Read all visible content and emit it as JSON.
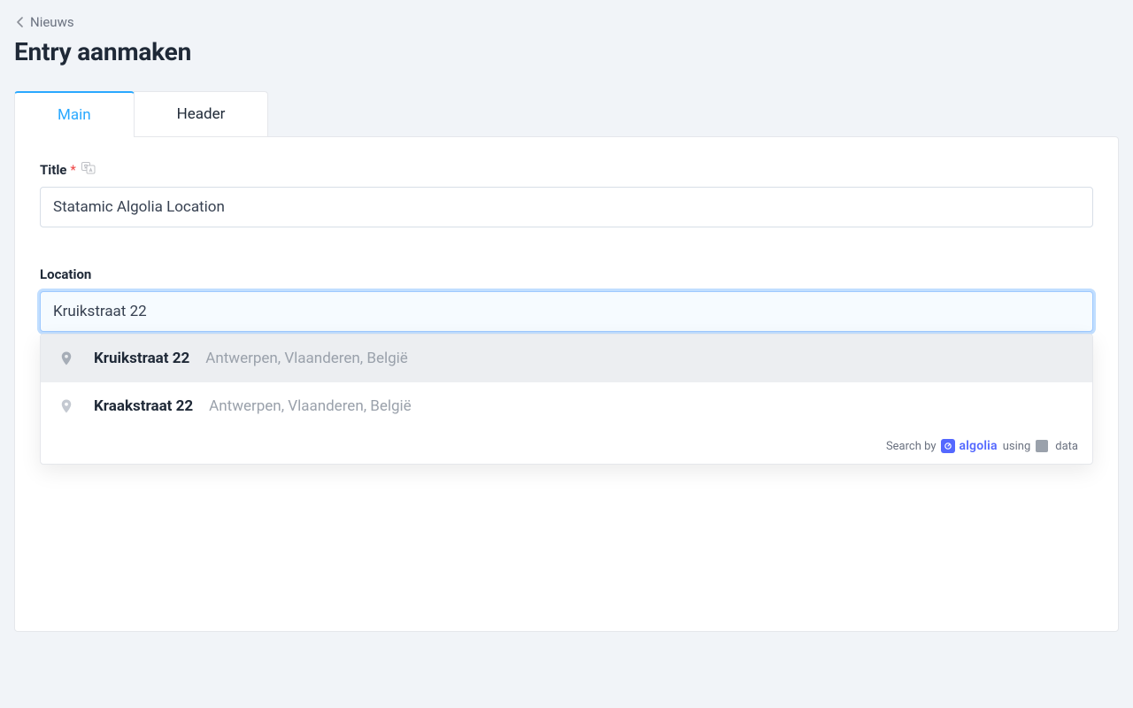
{
  "breadcrumb": {
    "label": "Nieuws"
  },
  "page": {
    "title": "Entry aanmaken"
  },
  "tabs": [
    {
      "id": "main",
      "label": "Main",
      "active": true
    },
    {
      "id": "header",
      "label": "Header",
      "active": false
    }
  ],
  "fields": {
    "title": {
      "label": "Title",
      "required_mark": "*",
      "value": "Statamic Algolia Location"
    },
    "location": {
      "label": "Location",
      "value": "Kruikstraat 22"
    }
  },
  "suggestions": [
    {
      "primary": "Kruikstraat 22",
      "secondary": "Antwerpen, Vlaanderen, België",
      "highlight": true
    },
    {
      "primary": "Kraakstraat 22",
      "secondary": "Antwerpen, Vlaanderen, België",
      "highlight": false
    }
  ],
  "dd_footer": {
    "search_by": "Search by",
    "algolia": "algolia",
    "using": "using",
    "data": "data"
  }
}
